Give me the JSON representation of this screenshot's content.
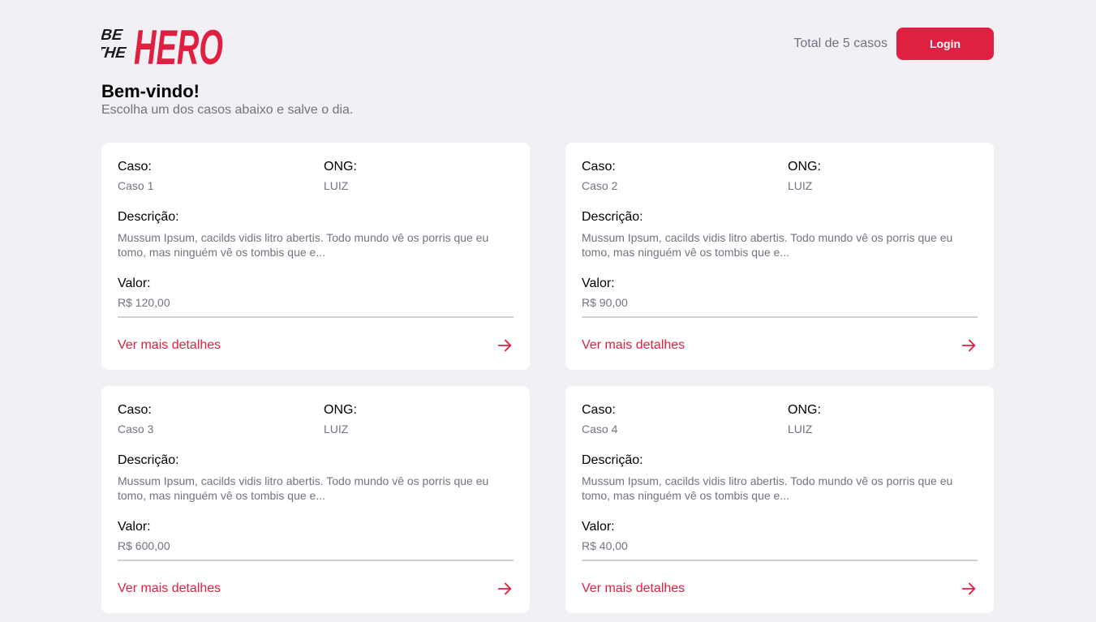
{
  "logo": {
    "line1": "BE",
    "line2": "THE",
    "word": "HERO"
  },
  "header": {
    "total": "Total de 5 casos",
    "login_label": "Login"
  },
  "welcome": {
    "title": "Bem-vindo!",
    "subtitle": "Escolha um dos casos abaixo e salve o dia."
  },
  "labels": {
    "caso": "Caso:",
    "ong": "ONG:",
    "descricao": "Descrição:",
    "valor": "Valor:",
    "details": "Ver mais detalhes"
  },
  "colors": {
    "accent": "#e02041",
    "background": "#f0f0f5",
    "muted": "#737380"
  },
  "cases": [
    {
      "caso": "Caso 1",
      "ong": "LUIZ",
      "descricao": "Mussum Ipsum, cacilds vidis litro abertis. Todo mundo vê os porris que eu tomo, mas ninguém vê os tombis que e...",
      "valor": "R$ 120,00"
    },
    {
      "caso": "Caso 2",
      "ong": "LUIZ",
      "descricao": "Mussum Ipsum, cacilds vidis litro abertis. Todo mundo vê os porris que eu tomo, mas ninguém vê os tombis que e...",
      "valor": "R$ 90,00"
    },
    {
      "caso": "Caso 3",
      "ong": "LUIZ",
      "descricao": "Mussum Ipsum, cacilds vidis litro abertis. Todo mundo vê os porris que eu tomo, mas ninguém vê os tombis que e...",
      "valor": "R$ 600,00"
    },
    {
      "caso": "Caso 4",
      "ong": "LUIZ",
      "descricao": "Mussum Ipsum, cacilds vidis litro abertis. Todo mundo vê os porris que eu tomo, mas ninguém vê os tombis que e...",
      "valor": "R$ 40,00"
    }
  ]
}
